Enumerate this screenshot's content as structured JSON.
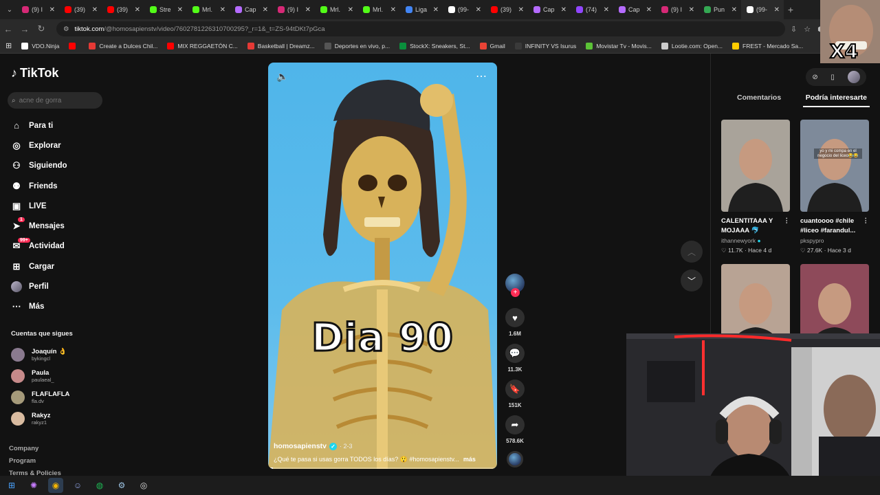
{
  "browser": {
    "tabs": [
      {
        "label": "(9) I",
        "color": "#d62976"
      },
      {
        "label": "(39)",
        "color": "#ff0000"
      },
      {
        "label": "(39)",
        "color": "#ff0000"
      },
      {
        "label": "Stre",
        "color": "#53fc18"
      },
      {
        "label": "Mrl.",
        "color": "#53fc18"
      },
      {
        "label": "Cap",
        "color": "#b56bff"
      },
      {
        "label": "(9) I",
        "color": "#d62976"
      },
      {
        "label": "Mrl.",
        "color": "#53fc18"
      },
      {
        "label": "Mrl.",
        "color": "#53fc18"
      },
      {
        "label": "Liga",
        "color": "#4285f4"
      },
      {
        "label": "(99-",
        "color": "#ffffff"
      },
      {
        "label": "(39)",
        "color": "#ff0000"
      },
      {
        "label": "Cap",
        "color": "#b56bff"
      },
      {
        "label": "(74)",
        "color": "#9146ff"
      },
      {
        "label": "Cap",
        "color": "#b56bff"
      },
      {
        "label": "(9) I",
        "color": "#d62976"
      },
      {
        "label": "Pun",
        "color": "#34a853"
      },
      {
        "label": "(99-",
        "color": "#ffffff"
      }
    ],
    "url_domain": "tiktok.com",
    "url_path": "/@homosapienstv/video/7602781226310700295?_r=1&_t=ZS-94tDKt7pGca",
    "bookmarks": [
      {
        "label": "VDO.Ninja",
        "color": "#ffffff"
      },
      {
        "label": "",
        "color": "#ff0000"
      },
      {
        "label": "Create a Dulces Chil...",
        "color": "#e53935"
      },
      {
        "label": "MIX REGGAETÓN C...",
        "color": "#ff0000"
      },
      {
        "label": "Basketball | Dreamz...",
        "color": "#e53935"
      },
      {
        "label": "Deportes en vivo, p...",
        "color": "#555555"
      },
      {
        "label": "StockX: Sneakers, St...",
        "color": "#0a8f3c"
      },
      {
        "label": "Gmail",
        "color": "#ea4335"
      },
      {
        "label": "INFINITY VS Isurus",
        "color": "#3a3a3a"
      },
      {
        "label": "Movistar Tv - Movis...",
        "color": "#5bc236"
      },
      {
        "label": "Lootie.com: Open...",
        "color": "#cccccc"
      },
      {
        "label": "FREST - Mercado Sa...",
        "color": "#ffcc00"
      }
    ]
  },
  "sidebar": {
    "logo": "TikTok",
    "search_placeholder": "acne de gorra",
    "items": [
      {
        "label": "Para ti",
        "icon": "⌂",
        "name": "home-icon"
      },
      {
        "label": "Explorar",
        "icon": "◎",
        "name": "compass-icon"
      },
      {
        "label": "Siguiendo",
        "icon": "⚇",
        "name": "following-icon"
      },
      {
        "label": "Friends",
        "icon": "⚉",
        "name": "friends-icon"
      },
      {
        "label": "LIVE",
        "icon": "▣",
        "name": "live-icon"
      },
      {
        "label": "Mensajes",
        "icon": "➤",
        "name": "messages-icon",
        "badge": "1"
      },
      {
        "label": "Actividad",
        "icon": "✉",
        "name": "activity-icon",
        "badge": "99+"
      },
      {
        "label": "Cargar",
        "icon": "⊞",
        "name": "upload-icon"
      },
      {
        "label": "Perfil",
        "icon": "",
        "name": "profile-avatar"
      },
      {
        "label": "Más",
        "icon": "⋯",
        "name": "more-icon"
      }
    ],
    "following_title": "Cuentas que sigues",
    "following": [
      {
        "name": "Joaquín 👌",
        "handle": "bykingcl",
        "color": "#8a7a8f"
      },
      {
        "name": "Paula",
        "handle": "paulaeal_",
        "color": "#c78a8a"
      },
      {
        "name": "FLAFLAFLA",
        "handle": "fla.dv",
        "color": "#a59a7a"
      },
      {
        "name": "Rakyz",
        "handle": "rakyz1",
        "color": "#d9bba0"
      }
    ],
    "footer": [
      "Company",
      "Program",
      "Terms & Policies"
    ]
  },
  "video": {
    "overlay_text": "Dia 90",
    "author": "homosapienstv",
    "date": "· 2-3",
    "caption": "¿Qué te pasa si usas gorra TODOS los días? 😲 #homosapienstv...",
    "more_label": "más",
    "progress": 0.02
  },
  "actions": {
    "likes": "1.6M",
    "comments": "11.3K",
    "saves": "151K",
    "shares": "578.6K"
  },
  "right_panel": {
    "tabs": [
      "Comentarios",
      "Podría interesarte"
    ],
    "recommendations": [
      {
        "title": "CALENTITAAA Y MOJAAA 🐬",
        "author": "ithannewyork",
        "likes": "11.7K",
        "when": "Hace 4 d",
        "bg": "#a9a39a",
        "verified": true
      },
      {
        "title": "cuantoooo #chile #liceo #farandul...",
        "author": "pkspypro",
        "likes": "27.6K",
        "when": "Hace 3 d",
        "bg": "#7e8a9a",
        "caption": "yo y mi compa en el negocio del liceo😂😂"
      },
      {
        "title": "",
        "author": "",
        "likes": "",
        "when": "",
        "bg": "#b8a394"
      },
      {
        "title": "",
        "author": "",
        "likes": "",
        "when": "",
        "bg": "#8e4a5a"
      }
    ]
  },
  "overlay": {
    "meme_text": "X4"
  }
}
